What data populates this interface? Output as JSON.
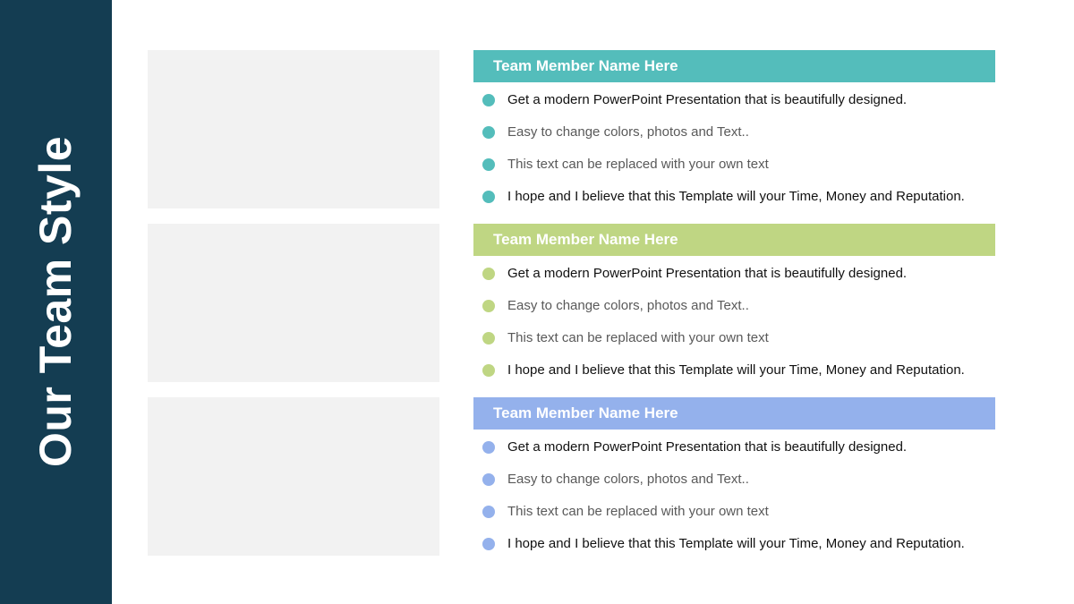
{
  "slide": {
    "title": "Our Team Style",
    "colors": {
      "sidebar": "#143d52",
      "photo_placeholder": "#f2f2f2"
    }
  },
  "members": [
    {
      "name": "Team Member Name Here",
      "accent": "#54bdbb",
      "bullets": [
        "Get a modern PowerPoint  Presentation that is beautifully designed.",
        "Easy to change colors, photos and Text..",
        "This text can be replaced with your own text",
        "I hope and I believe that this Template will your Time, Money and Reputation."
      ]
    },
    {
      "name": "Team Member Name Here",
      "accent": "#bfd683",
      "bullets": [
        "Get a modern PowerPoint  Presentation that is beautifully designed.",
        "Easy to change colors, photos and Text..",
        "This text can be replaced with your own text",
        "I hope and I believe that this Template will your Time, Money and Reputation."
      ]
    },
    {
      "name": "Team Member Name Here",
      "accent": "#94b1ec",
      "bullets": [
        "Get a modern PowerPoint  Presentation that is beautifully designed.",
        "Easy to change colors, photos and Text..",
        "This text can be replaced with your own text",
        "I hope and I believe that this Template will your Time, Money and Reputation."
      ]
    }
  ]
}
